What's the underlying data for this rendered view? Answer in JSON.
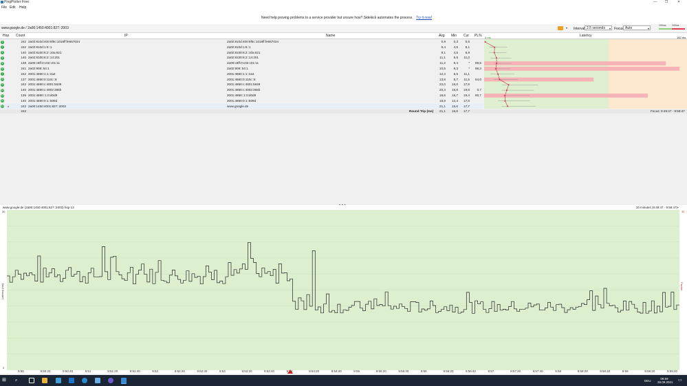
{
  "window": {
    "title": "PingPlotter Free",
    "controls": [
      "—",
      "❐",
      "✕"
    ]
  },
  "menu": [
    "File",
    "Edit",
    "Help"
  ],
  "banner": {
    "text": "Need help proving problems to a service provider but unsure how? Sidekick automates the process.",
    "link": "Try it now!"
  },
  "toolbar": {
    "target": "www.google.de / 2a00:1450:4001:827::2003",
    "interval_label": "Interval",
    "interval_value": "2.5 seconds",
    "focus_label": "Focus",
    "focus_value": "Auto",
    "scale_100": "100ms",
    "scale_200": "200ms"
  },
  "columns": {
    "hop": "Hop",
    "count": "Count",
    "ip": "IP",
    "name": "Name",
    "avg": "Avg",
    "min": "Min",
    "cur": "Cur",
    "pl": "PL%",
    "latency": "Latency",
    "lat_min": "0 ms",
    "lat_max": "182 ms"
  },
  "hops": [
    {
      "hop": "1",
      "count": "242",
      "ip": "2a02:810d:400:6f5c:1018ff:fe667034",
      "name": "2a02:810d:400:6f5c:1018ff:fe667034",
      "avg": "0,9",
      "min": "0,3",
      "cur": "0,5",
      "pl": ""
    },
    {
      "hop": "2",
      "count": "242",
      "ip": "2a02:810d:1:6::1",
      "name": "2a02:810d:1:6::1",
      "avg": "9,4",
      "min": "4,5",
      "cur": "8,1",
      "pl": ""
    },
    {
      "hop": "3",
      "count": "140",
      "ip": "2a02:8100:6:2::10a:621",
      "name": "2a02:8100:6:2::10a:621",
      "avg": "9,1",
      "min": "4,5",
      "cur": "6,9",
      "pl": ""
    },
    {
      "hop": "4",
      "count": "140",
      "ip": "2a02:8100:6:2::14:201",
      "name": "2a02:8100:6:2::14:201",
      "avg": "11,1",
      "min": "5,6",
      "cur": "11,0",
      "pl": ""
    },
    {
      "hop": "5",
      "count": "138",
      "ip": "2a00:c6ff:0:c02:c01:11",
      "name": "2a00:c6ff:0:c02:c01:11",
      "avg": "11,2",
      "min": "9,4",
      "cur": "*",
      "pl": "89,6"
    },
    {
      "hop": "6",
      "count": "241",
      "ip": "2a02:908::54:1",
      "name": "2a02:908::54:1",
      "avg": "10,5",
      "min": "9,3",
      "cur": "*",
      "pl": "96,3"
    },
    {
      "hop": "7",
      "count": "242",
      "ip": "2001:4860:1:1::2a4",
      "name": "2001:4860:1:1::2a4",
      "avg": "12,4",
      "min": "5,5",
      "cur": "11,1",
      "pl": ""
    },
    {
      "hop": "8",
      "count": "137",
      "ip": "2001:4860:0:110c::8",
      "name": "2001:4860:0:110c::8",
      "avg": "13,8",
      "min": "8,7",
      "cur": "11,5",
      "pl": "54,0"
    },
    {
      "hop": "9",
      "count": "242",
      "ip": "2001:4860:c:4001:5639",
      "name": "2001:4860:c:4001:5639",
      "avg": "22,0",
      "min": "16,0",
      "cur": "17,9",
      "pl": ""
    },
    {
      "hop": "10",
      "count": "140",
      "ip": "2001:4860:c:4002:365b",
      "name": "2001:4860:c:4002:365b",
      "avg": "20,3",
      "min": "15,8",
      "cur": "19,8",
      "pl": "0,7"
    },
    {
      "hop": "11",
      "count": "135",
      "ip": "2001:4860::1:0:d0d8",
      "name": "2001:4860::1:0:d0d8",
      "avg": "18,6",
      "min": "16,7",
      "cur": "19,4",
      "pl": "80,7"
    },
    {
      "hop": "12",
      "count": "140",
      "ip": "2001:4860:0:1::509d",
      "name": "2001:4860:0:1::509d",
      "avg": "18,8",
      "min": "12,4",
      "cur": "17,8",
      "pl": ""
    },
    {
      "hop": "13",
      "count": "242",
      "ip": "2a00:1450:4001:827::2003",
      "name": "www.google.de",
      "avg": "21,1",
      "min": "15,6",
      "cur": "17,7",
      "pl": ""
    }
  ],
  "summary": {
    "count": "242",
    "label": "Round Trip (ms)",
    "avg": "21,1",
    "min": "15,6",
    "cur": "17,7",
    "focus": "Focus: 9:49:47 - 9:59:47"
  },
  "graph": {
    "title": "www.google.de (2a00:1450:4001:827::2003) hop 13",
    "range": "10 minutes (9:49:47 - 9:59:47)",
    "y_left_top": "30",
    "y_left_label": "Latency (ms)",
    "y_right_top": "30",
    "y_right_label": "Packet Loss %",
    "y_zero": "0",
    "x_ticks": [
      "9:50",
      "9:50:20",
      "9:50:40",
      "9:51",
      "9:51:20",
      "9:51:40",
      "9:52",
      "9:52:20",
      "9:52:40",
      "9:53",
      "9:53:20",
      "9:53:40",
      "9:54",
      "9:54:20",
      "9:54:40",
      "9:55",
      "9:55:20",
      "9:55:40",
      "9:56",
      "9:56:20",
      "9:56:40",
      "9:57",
      "9:57:20",
      "9:57:40",
      "9:58",
      "9:58:20",
      "9:58:40",
      "9:59",
      "9:59:20",
      "9:59:40"
    ]
  },
  "tray": {
    "lang": "DEU",
    "time": "09:59",
    "date": "28.09.2021"
  },
  "colors": {
    "hop_ok": "#36a84a",
    "latency_green": "#dff0d0",
    "latency_orange": "#fde7cf",
    "loss_pink": "#f5b3b8",
    "graph_line": "#222222"
  }
}
